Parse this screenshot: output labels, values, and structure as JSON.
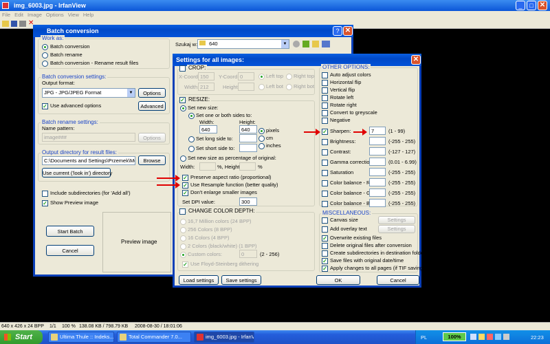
{
  "main_window": {
    "title": "img_6003.jpg - IrfanView",
    "menu": [
      "File",
      "Edit",
      "Image",
      "Options",
      "View",
      "Help"
    ],
    "status": [
      "640 x 426 x 24 BPP",
      "1/1",
      "100 %",
      "138.08 KB / 798.79 KB",
      "2008-08-30 / 18:01:06"
    ]
  },
  "batch": {
    "title": "Batch conversion",
    "work_as": {
      "header": "Work as:",
      "options": [
        "Batch conversion",
        "Batch rename",
        "Batch conversion - Rename result files"
      ],
      "selected": "Batch conversion"
    },
    "conv_settings": {
      "header": "Batch conversion settings:",
      "output_format_label": "Output format:",
      "output_format_value": "JPG - JPG/JPEG Format",
      "options_btn": "Options",
      "use_advanced_label": "Use advanced options",
      "use_advanced_checked": true,
      "advanced_btn": "Advanced"
    },
    "rename_settings": {
      "header": "Batch rename settings:",
      "name_pattern_label": "Name pattern:",
      "name_pattern_value": "image###",
      "options_btn": "Options"
    },
    "output_dir": {
      "header": "Output directory for result files:",
      "path": "C:\\Documents and Settings\\Przemek\\Moje",
      "browse_btn": "Browse",
      "use_current_btn": "Use current ('look in') directory"
    },
    "include_subdirs": "Include subdirectories (for 'Add all')",
    "show_preview": "Show Preview image",
    "start_btn": "Start Batch",
    "cancel_btn": "Cancel",
    "preview_text": "Preview image",
    "look_in_label": "Szukaj w:",
    "look_in_value": "640"
  },
  "settings": {
    "title": "Settings for all images:",
    "crop": {
      "label": "CROP:",
      "xcoord_label": "X-Coord.:",
      "xcoord": "150",
      "ycoord_label": "Y-Coord.:",
      "ycoord": "0",
      "width_label": "Width:",
      "width": "212",
      "height_label": "Height:",
      "height": "",
      "positions": [
        "Left top",
        "Right top",
        "Left bot",
        "Right bot"
      ]
    },
    "resize": {
      "label": "RESIZE:",
      "set_new_size": "Set new size:",
      "one_or_both": "Set one or both sides to:",
      "width_label": "Width:",
      "width": "640",
      "height_label": "Height:",
      "height": "640",
      "units": [
        "pixels",
        "cm",
        "inches"
      ],
      "long_side": "Set long side to:",
      "short_side": "Set short side to:",
      "percentage": "Set new size as percentage of original:",
      "pct_width_label": "Width:",
      "pct_height_label": "%, Height:",
      "pct_unit": "%",
      "preserve": "Preserve aspect ratio (proportional)",
      "resample": "Use Resample function (better quality)",
      "dont_enlarge": "Don't enlarge smaller images",
      "dpi_label": "Set DPI value:",
      "dpi": "300"
    },
    "color_depth": {
      "label": "CHANGE COLOR DEPTH:",
      "options": [
        "16,7 Million colors (24 BPP)",
        "256 Colors (8 BPP)",
        "16 Colors (4 BPP)",
        "2 Colors (black/white) (1 BPP)",
        "Custom colors:"
      ],
      "custom_value": "0",
      "custom_range": "(2 - 256)",
      "floyd": "Use Floyd-Steinberg dithering"
    },
    "other": {
      "header": "OTHER OPTIONS:",
      "checks": [
        "Auto adjust colors",
        "Horizontal flip",
        "Vertical flip",
        "Rotate left",
        "Rotate right",
        "Convert to greyscale",
        "Negative"
      ],
      "values": [
        {
          "label": "Sharpen:",
          "value": "7",
          "range": "(1 - 99)",
          "checked": true
        },
        {
          "label": "Brightness:",
          "value": "",
          "range": "(-255 - 255)",
          "checked": false
        },
        {
          "label": "Contrast:",
          "value": "",
          "range": "(-127 - 127)",
          "checked": false
        },
        {
          "label": "Gamma correction:",
          "value": "",
          "range": "(0.01 - 6.99)",
          "checked": false
        },
        {
          "label": "Saturation",
          "value": "",
          "range": "(-255 - 255)",
          "checked": false
        },
        {
          "label": "Color balance - R:",
          "value": "",
          "range": "(-255 - 255)",
          "checked": false
        },
        {
          "label": "Color balance - G:",
          "value": "",
          "range": "(-255 - 255)",
          "checked": false
        },
        {
          "label": "Color balance - B:",
          "value": "",
          "range": "(-255 - 255)",
          "checked": false
        }
      ]
    },
    "misc": {
      "header": "MISCELLANEOUS:",
      "canvas": "Canvas size",
      "overlay": "Add overlay text",
      "settings_btn": "Settings",
      "checks": [
        {
          "label": "Overwrite existing files",
          "checked": true
        },
        {
          "label": "Delete original files after conversion",
          "checked": false
        },
        {
          "label": "Create subdirectories in destination folder",
          "checked": false
        },
        {
          "label": "Save files with original date/time",
          "checked": true
        },
        {
          "label": "Apply changes to all pages (if TIF saving)",
          "checked": true
        }
      ]
    },
    "load_btn": "Load settings",
    "save_btn": "Save settings",
    "ok_btn": "OK",
    "cancel_btn": "Cancel"
  },
  "taskbar": {
    "start": "Start",
    "items": [
      "Ultima Thule :: Indeks...",
      "Total Commander 7.0...",
      "img_6003.jpg - IrfanV..."
    ],
    "lang": "PL",
    "battery": "100%",
    "clock": "22:23"
  }
}
